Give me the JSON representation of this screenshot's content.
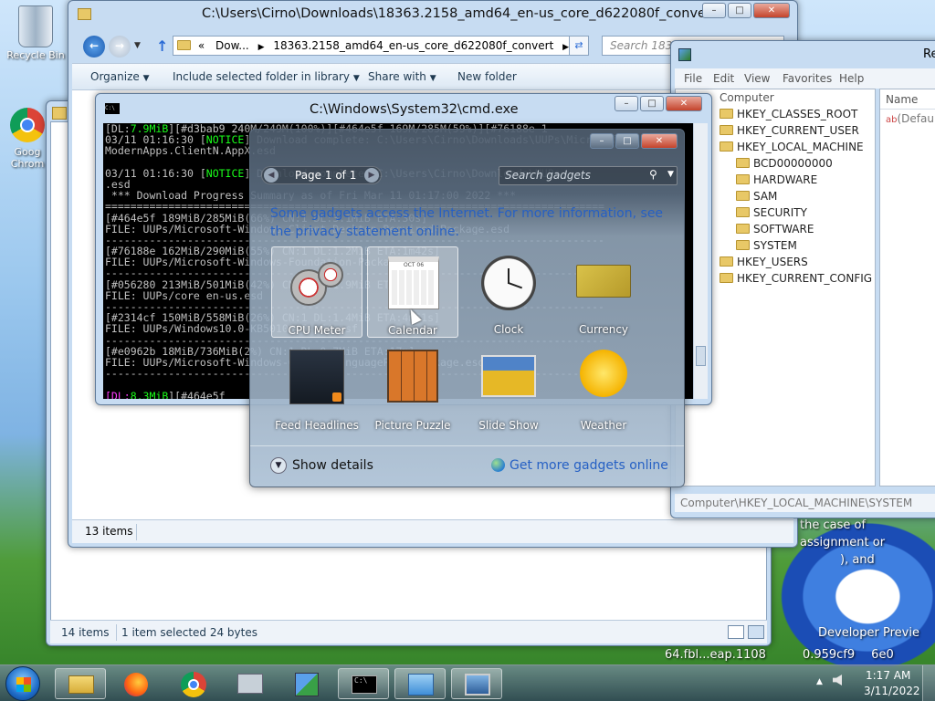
{
  "desktop": {
    "recycle_bin": "Recycle Bin",
    "chrome_label_1": "Goog",
    "chrome_label_2": "Chrom"
  },
  "explorer": {
    "title": "C:\\Users\\Cirno\\Downloads\\18363.2158_amd64_en-us_core_d622080f_convert",
    "crumb_ellipsis": "«",
    "crumb_1": "Dow...",
    "crumb_2": "18363.2158_amd64_en-us_core_d622080f_convert",
    "search_placeholder": "Search 18363",
    "toolbar": {
      "organize": "Organize",
      "include": "Include selected folder in library",
      "share": "Share with",
      "new_folder": "New folder"
    },
    "status_items": "13 items"
  },
  "explorer_back": {
    "status_items": "14 items",
    "status_selected": "1 item selected  24 bytes"
  },
  "regedit": {
    "title": "Re",
    "menu": [
      "File",
      "Edit",
      "View",
      "Favorites",
      "Help"
    ],
    "tree_root": "Computer",
    "tree": [
      "HKEY_CLASSES_ROOT",
      "HKEY_CURRENT_USER",
      "HKEY_LOCAL_MACHINE",
      "BCD00000000",
      "HARDWARE",
      "SAM",
      "SECURITY",
      "SOFTWARE",
      "SYSTEM",
      "HKEY_USERS",
      "HKEY_CURRENT_CONFIG"
    ],
    "col_name": "Name",
    "value_default": "(Defaul",
    "statusbar": "Computer\\HKEY_LOCAL_MACHINE\\SYSTEM"
  },
  "cmd": {
    "title": "C:\\Windows\\System32\\cmd.exe",
    "icon": "C:\\",
    "lines": [
      "[DL:7.9MiB][#d3bab9 240M/249M(100%)][#464e5f 169M/285M(59%)][#76188e 1",
      "03/11 01:16:30 [NOTICE] Download complete: C:\\Users\\Cirno\\Downloads\\UUPs\\Microsoft",
      "ModernApps.ClientN.AppX.esd",
      "",
      "03/11 01:16:30 [NOTICE] Download complete: C:\\Users\\Cirno\\Downloads\\UUPs",
      ".esd",
      " *** Download Progress Summary as of Fri Mar 11 01:17:00 2022 ***",
      "===============================================================================",
      "[#464e5f 189MiB/285MiB(66%) CN:1 DL:3.1MiB ETA:30s]",
      "FILE: UUPs/Microsoft-Windows-Client-Desktop-Required-Package.esd",
      "-------------------------------------------------------------------------------",
      "[#76188e 162MiB/290MiB(55%) CN:1 DL:1.2MiB ETA:1m42s]",
      "FILE: UUPs/Microsoft-Windows-Foundation-Package.esd",
      "-------------------------------------------------------------------------------",
      "[#056280 213MiB/501MiB(42%) CN:1 DL:1.9MiB ETA:2m31s]",
      "FILE: UUPs/core_en-us.esd",
      "-------------------------------------------------------------------------------",
      "[#2314cf 150MiB/558MiB(26%) CN:1 DL:1.4MiB ETA:4m51s]",
      "FILE: UUPs/Windows10.0-KB5010345-x64.psf",
      "-------------------------------------------------------------------------------",
      "[#e0962b 18MiB/736MiB(2%) CN:1 DL:0.7MiB ETA:17m]",
      "FILE: UUPs/Microsoft-Windows-Client-LanguagePack-Package.esd",
      "-------------------------------------------------------------------------------",
      ""
    ],
    "bottom_prefix": "[DL:",
    "bottom_speed": "8.3MiB",
    "bottom_rest": "][#464e5f",
    "top_speed": "7.9MiB"
  },
  "gadgets": {
    "page_label": "Page 1 of 1",
    "search_placeholder": "Search gadgets",
    "notice_line1": "Some gadgets access the Internet.  For more information, see",
    "notice_line2": "the privacy statement online.",
    "items": [
      {
        "name": "CPU Meter"
      },
      {
        "name": "Calendar"
      },
      {
        "name": "Clock"
      },
      {
        "name": "Currency"
      },
      {
        "name": "Feed Headlines"
      },
      {
        "name": "Picture Puzzle"
      },
      {
        "name": "Slide Show"
      },
      {
        "name": "Weather"
      }
    ],
    "calendar_month": "OCT 06",
    "show_details": "Show details",
    "more_online": "Get more gadgets online"
  },
  "wallpaper_text": {
    "line1": "the case of",
    "line2": "assignment or",
    "line3": "), and",
    "line4": "Developer Previe",
    "line5": "64.fbl...eap.1108",
    "line6": "0.959cf9",
    "line7": "6e0"
  },
  "taskbar": {
    "time": "1:17 AM",
    "date": "3/11/2022"
  },
  "colors": {
    "accent": "#1e5ea8",
    "link": "#2a6bd6",
    "cmd_green": "#1aff1a",
    "cmd_magenta": "#ff3bff"
  }
}
